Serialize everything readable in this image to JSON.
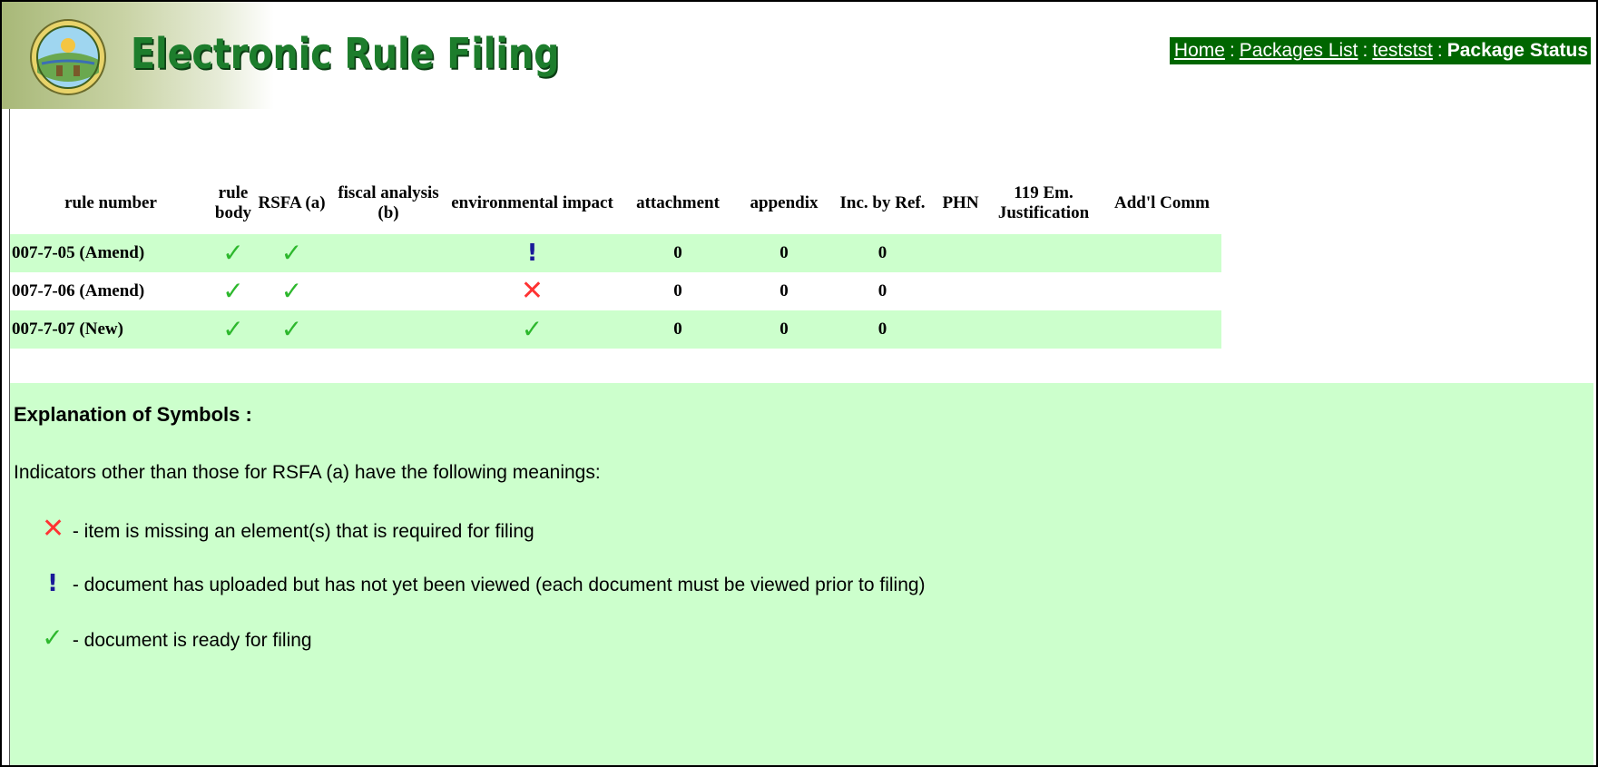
{
  "app": {
    "title": "Electronic Rule Filing"
  },
  "breadcrumb": {
    "home": "Home",
    "packages_list": "Packages List",
    "package": "teststst",
    "current": "Package Status",
    "separator": ":"
  },
  "table": {
    "headers": [
      "rule number",
      "rule body",
      "RSFA (a)",
      "fiscal analysis (b)",
      "environmental impact",
      "attachment",
      "appendix",
      "Inc. by Ref.",
      "PHN",
      "119 Em. Justification",
      "Add'l Comm"
    ],
    "rows": [
      {
        "rule_number": "007-7-05 (Amend)",
        "rule_body": "check",
        "rsfa": "check",
        "fiscal": "",
        "environmental": "bang",
        "attachment": "0",
        "appendix": "0",
        "inc_by_ref": "0",
        "phn": "",
        "em_justification": "",
        "addl_comm": ""
      },
      {
        "rule_number": "007-7-06 (Amend)",
        "rule_body": "check",
        "rsfa": "check",
        "fiscal": "",
        "environmental": "cross",
        "attachment": "0",
        "appendix": "0",
        "inc_by_ref": "0",
        "phn": "",
        "em_justification": "",
        "addl_comm": ""
      },
      {
        "rule_number": "007-7-07 (New)",
        "rule_body": "check",
        "rsfa": "check",
        "fiscal": "",
        "environmental": "check",
        "attachment": "0",
        "appendix": "0",
        "inc_by_ref": "0",
        "phn": "",
        "em_justification": "",
        "addl_comm": ""
      }
    ]
  },
  "symbols": {
    "check": "✓",
    "cross": "✕",
    "bang": "!"
  },
  "explanation": {
    "title": "Explanation of Symbols :",
    "intro": "Indicators other than those for RSFA (a) have the following meanings:",
    "items": [
      {
        "symbol": "cross",
        "text": " - item is missing an element(s) that is required for filing"
      },
      {
        "symbol": "bang",
        "text": " - document has uploaded but has not yet been viewed (each document must be viewed prior to filing)"
      },
      {
        "symbol": "check",
        "text": " - document is ready for filing"
      }
    ]
  },
  "colors": {
    "brand_green": "#006600",
    "row_shade": "#ccffcc",
    "check": "#2db82d",
    "cross": "#ff3333",
    "bang": "#1a1a99"
  }
}
